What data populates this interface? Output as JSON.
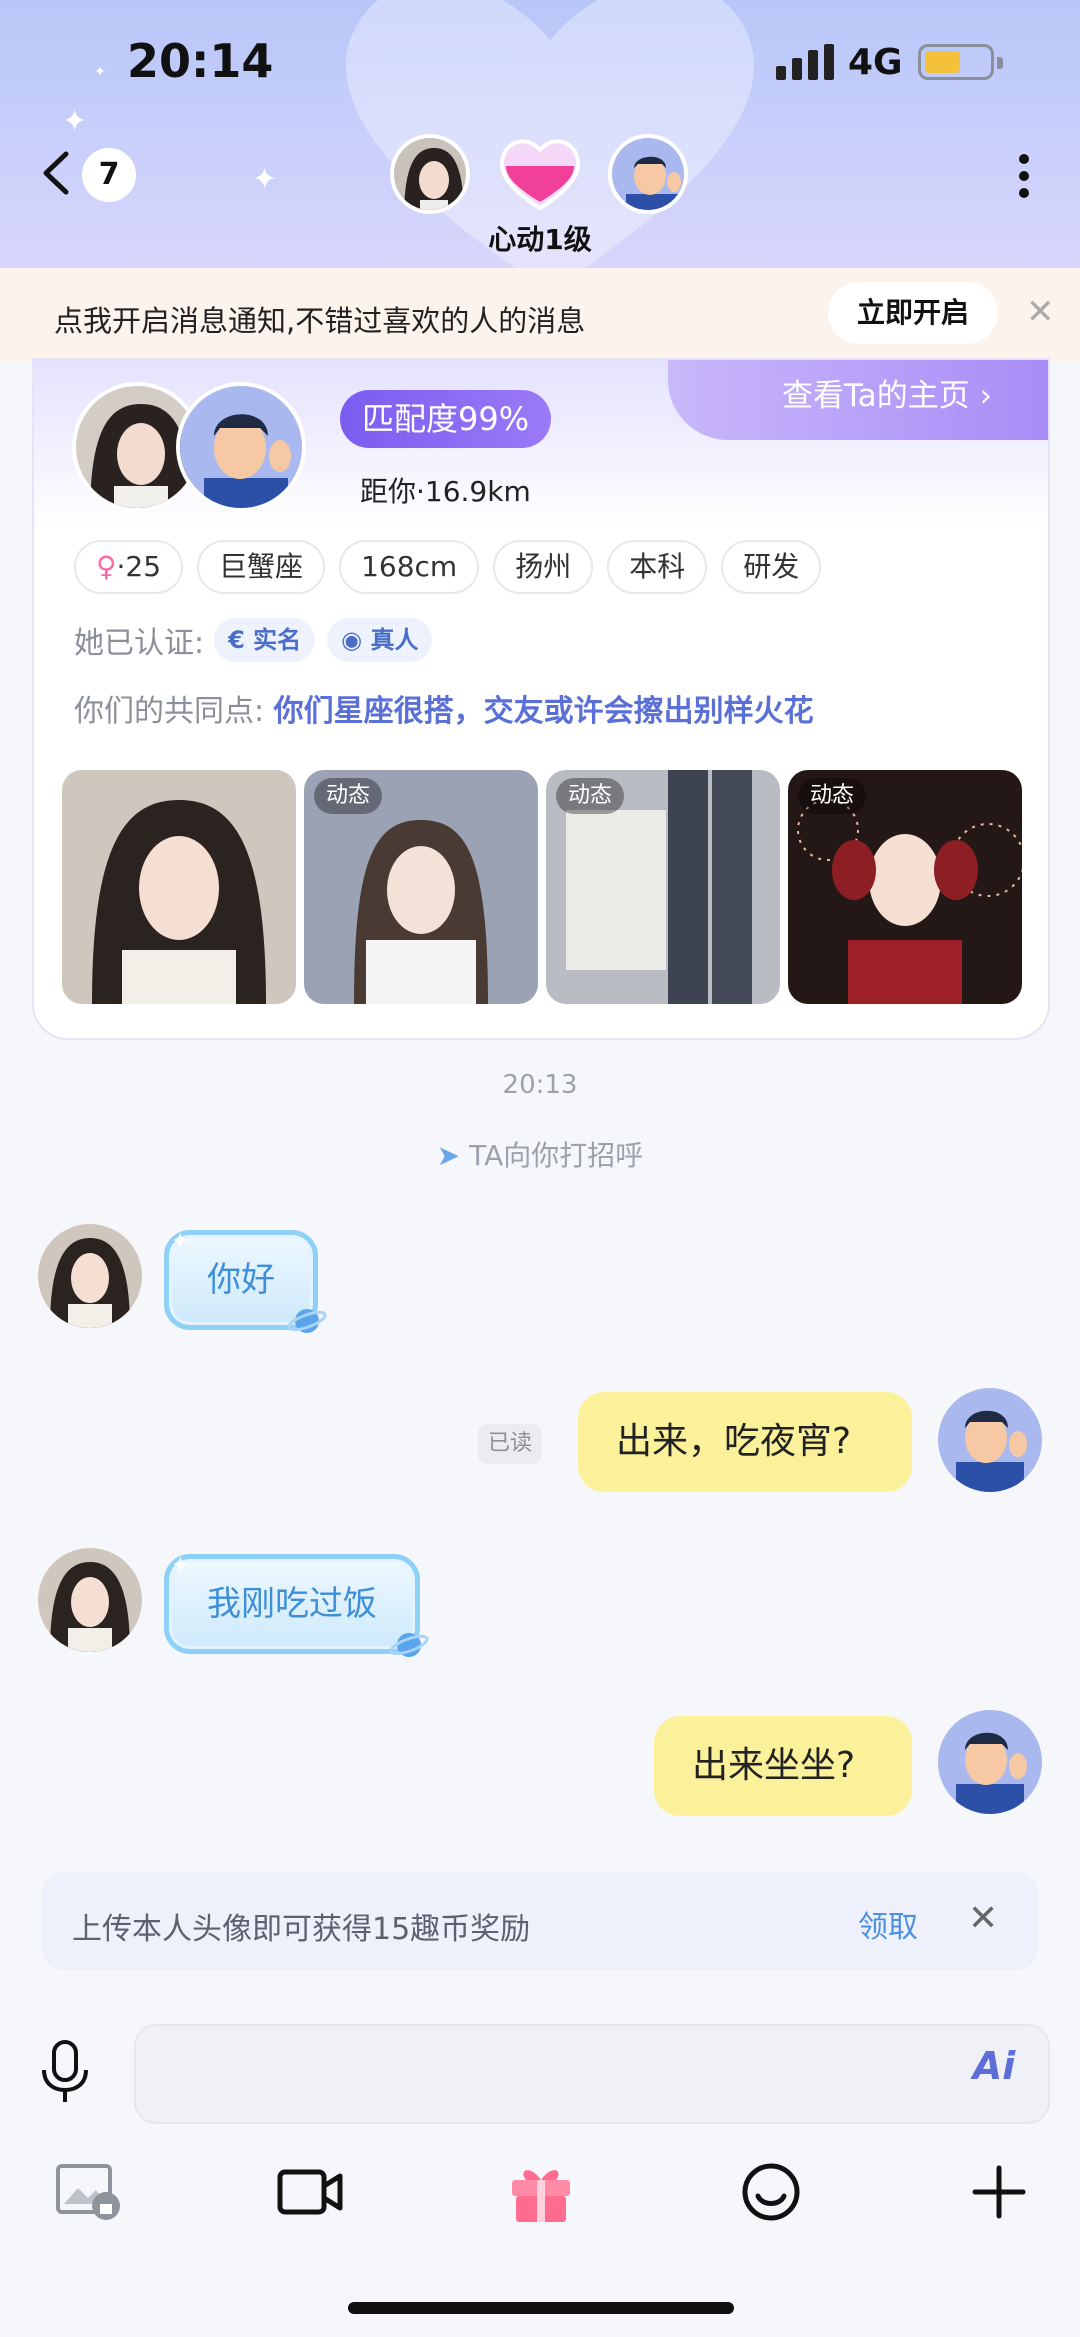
{
  "status_bar": {
    "time": "20:14",
    "network": "4G",
    "battery_level": 0.55
  },
  "nav": {
    "unread_count": "7",
    "level_label": "心动1级"
  },
  "notification": {
    "text": "点我开启消息通知,不错过喜欢的人的消息",
    "button": "立即开启",
    "close": "✕"
  },
  "profile": {
    "link_label": "查看Ta的主页 ›",
    "match_label": "匹配度99%",
    "distance": "距你·16.9km",
    "age_tag": "·25",
    "tags": [
      "巨蟹座",
      "168cm",
      "扬州",
      "本科",
      "研发"
    ],
    "verified_label": "她已认证:",
    "verified_badges": [
      "实名",
      "真人"
    ],
    "common_label": "你们的共同点:",
    "common_value": "你们星座很搭，交友或许会擦出别样火花",
    "photo_tags": [
      "",
      "动态",
      "动态",
      "动态"
    ]
  },
  "chat": {
    "time_separator": "20:13",
    "greeting_system": "TA向你打招呼",
    "messages": [
      {
        "side": "in",
        "text": "你好"
      },
      {
        "side": "out",
        "text": "出来，吃夜宵?"
      },
      {
        "side": "in",
        "text": "我刚吃过饭"
      },
      {
        "side": "out",
        "text": "出来坐坐?"
      }
    ],
    "read_status": "已读"
  },
  "reward": {
    "text": "上传本人头像即可获得15趣币奖励",
    "claim": "领取",
    "close": "✕"
  },
  "input": {
    "placeholder": "",
    "ai_label": "Ai"
  },
  "toolbar": {
    "icons": [
      "photo-lock-icon",
      "video-icon",
      "gift-icon",
      "emoji-icon",
      "plus-icon"
    ]
  },
  "colors": {
    "accent": "#7a5cf0",
    "bubble_out": "#fbf19a",
    "bubble_in_border": "#8fd0f6",
    "link": "#4d8fe0"
  }
}
